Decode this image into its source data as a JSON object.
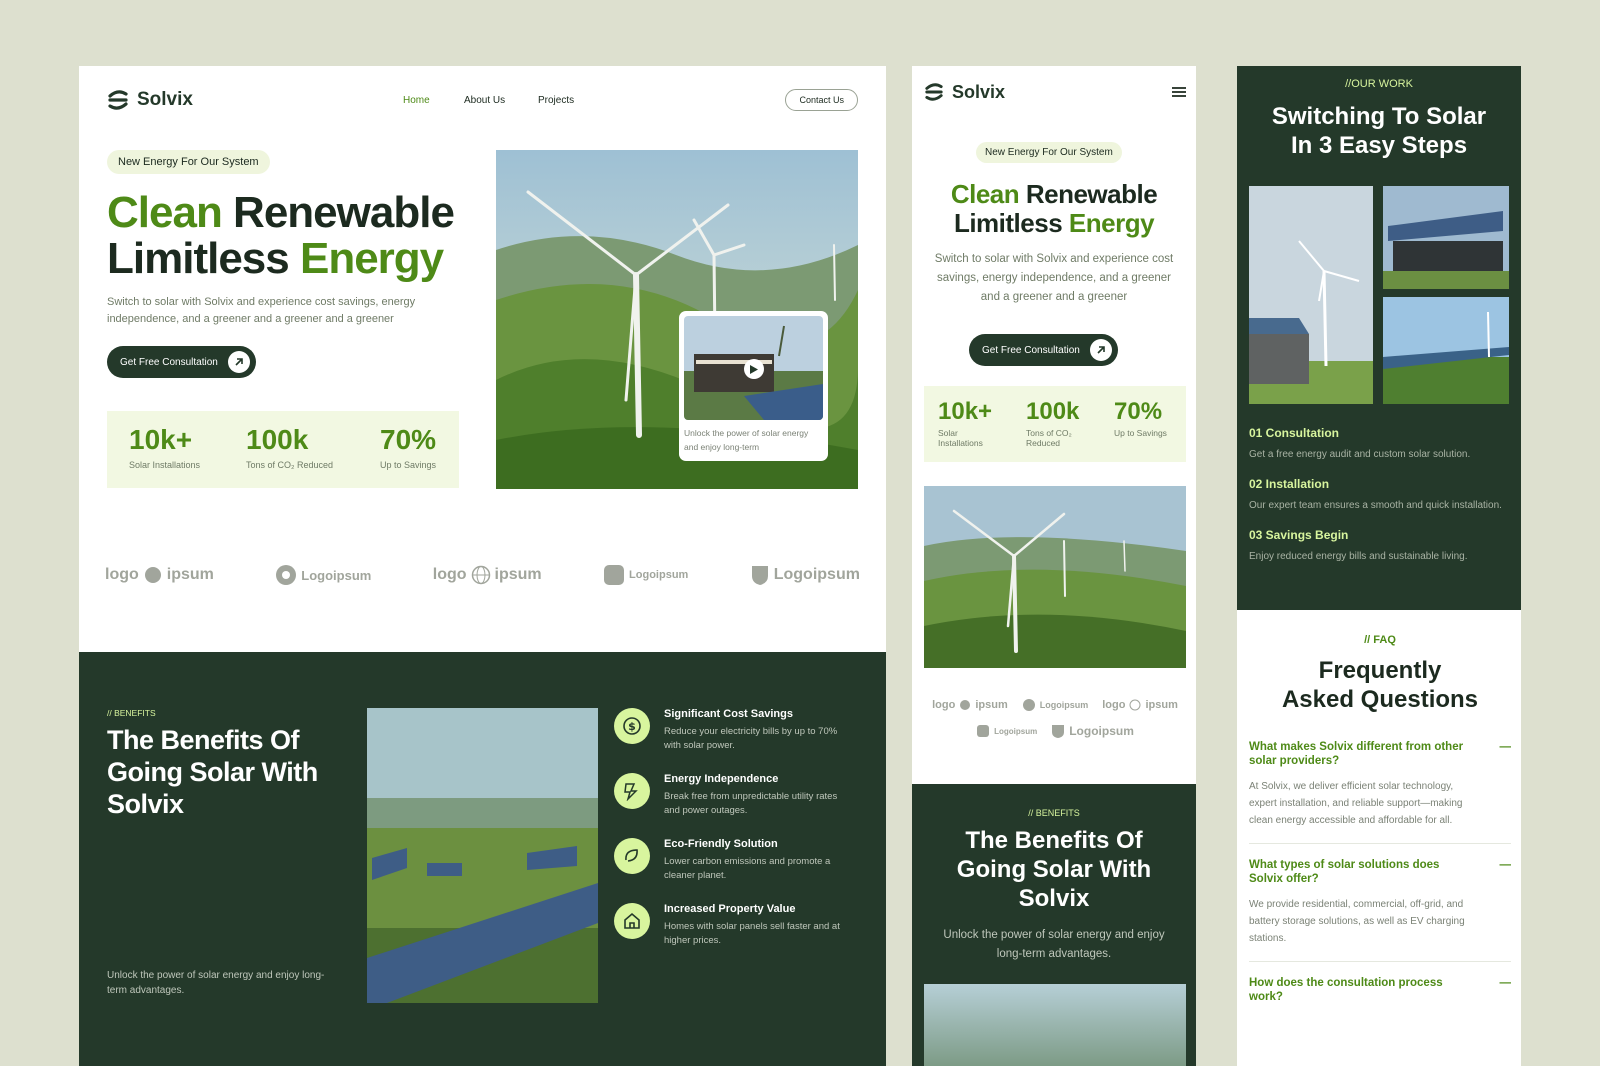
{
  "brand": "Solvix",
  "nav": {
    "home": "Home",
    "about": "About Us",
    "projects": "Projects",
    "contact": "Contact Us"
  },
  "hero": {
    "badge": "New Energy For Our System",
    "title_w1": "Clean",
    "title_w2": " Renewable",
    "title_w3": "Limitless",
    "title_w4": " Energy",
    "desc": "Switch to solar with Solvix and experience cost savings, energy independence, and a greener and a greener and a greener",
    "cta": "Get Free Consultation",
    "video_caption": "Unlock the power of solar energy and enjoy long-term"
  },
  "stats": [
    {
      "value": "10k+",
      "label": "Solar Installations"
    },
    {
      "value": "100k",
      "label": "Tons of CO₂ Reduced"
    },
    {
      "value": "70%",
      "label": "Up to Savings"
    }
  ],
  "mobile_stats": [
    {
      "value": "10k+",
      "label1": "Solar",
      "label2": "Installations"
    },
    {
      "value": "100k",
      "label1": "Tons of CO₂",
      "label2": "Reduced"
    },
    {
      "value": "70%",
      "label1": "Up to Savings",
      "label2": ""
    }
  ],
  "logos": [
    "logo",
    "ipsum",
    "Logoipsum",
    "logo",
    "ipsum",
    "Logoipsum",
    "Logoipsum"
  ],
  "benefits": {
    "tag": "// BENEFITS",
    "title": "The Benefits Of Going Solar With Solvix",
    "subtitle": "Unlock the power of solar energy and enjoy long-term advantages.",
    "items": [
      {
        "title": "Significant Cost Savings",
        "desc": "Reduce your electricity bills by up to 70% with solar power.",
        "icon": "dollar-icon"
      },
      {
        "title": "Energy Independence",
        "desc": "Break free from unpredictable utility rates and power outages.",
        "icon": "power-icon"
      },
      {
        "title": "Eco-Friendly Solution",
        "desc": "Lower carbon emissions and promote a cleaner planet.",
        "icon": "leaf-icon"
      },
      {
        "title": "Increased Property Value",
        "desc": "Homes with solar panels sell faster and at higher prices.",
        "icon": "home-icon"
      }
    ]
  },
  "work": {
    "tag": "//OUR WORK",
    "title": "Switching To Solar In 3 Easy Steps",
    "steps": [
      {
        "title": "01 Consultation",
        "desc": "Get a free energy audit and custom solar solution."
      },
      {
        "title": "02 Installation",
        "desc": "Our expert team ensures a smooth and quick installation."
      },
      {
        "title": "03 Savings Begin",
        "desc": "Enjoy reduced energy bills and sustainable living."
      }
    ]
  },
  "faq": {
    "tag": "// FAQ",
    "title": "Frequently Asked Questions",
    "items": [
      {
        "q": "What makes Solvix different from other solar providers?",
        "a": "At Solvix, we deliver efficient solar technology, expert installation, and reliable support—making clean energy accessible and affordable for all."
      },
      {
        "q": "What types of solar solutions does Solvix offer?",
        "a": "We provide residential, commercial, off-grid, and battery storage solutions, as well as EV charging stations."
      },
      {
        "q": "How does the consultation process work?",
        "a": ""
      }
    ]
  },
  "colors": {
    "accent": "#4e8a17",
    "dark": "#24392a",
    "lime": "#d8f59e",
    "background": "#dde0cf"
  }
}
